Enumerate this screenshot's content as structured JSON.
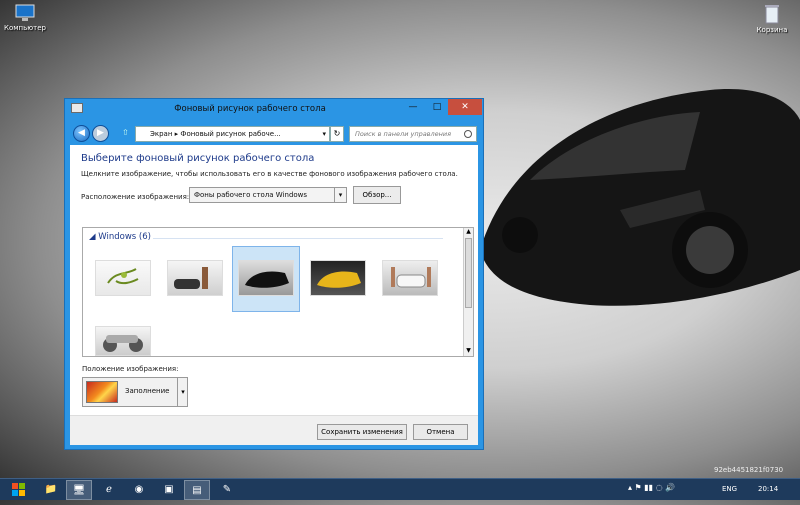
{
  "desktop": {
    "icons": [
      {
        "label": "Компьютер",
        "icon": "computer-icon"
      },
      {
        "label": "Корзина",
        "icon": "recycle-bin-icon"
      }
    ],
    "watermark": "92eb4451821f0730"
  },
  "window": {
    "title": "Фоновый рисунок рабочего стола",
    "buttons": {
      "minimize": "—",
      "maximize": "□",
      "close": "✕"
    },
    "address": {
      "breadcrumb_root": "Экран",
      "breadcrumb_current": "Фоновый рисунок рабоче...",
      "search_placeholder": "Поиск в панели управления"
    },
    "heading": "Выберите фоновый рисунок рабочего стола",
    "description": "Щелкните изображение, чтобы использовать его в качестве фонового изображения рабочего стола.",
    "location": {
      "label": "Расположение изображения:",
      "value": "Фоны рабочего стола Windows",
      "browse_label": "Обзор..."
    },
    "gallery": {
      "group_label": "Windows (6)",
      "items": [
        "plant",
        "woman-car",
        "black-car",
        "yellow-car",
        "white-car",
        "silver-car"
      ],
      "selected_index": 2
    },
    "position": {
      "label": "Положение изображения:",
      "value": "Заполнение"
    },
    "save_label": "Сохранить изменения",
    "cancel_label": "Отмена"
  },
  "taskbar": {
    "lang": "ENG",
    "time": "20:14"
  },
  "colors": {
    "titlebar": "#2b95e4",
    "close": "#c74f3e",
    "heading": "#1d3a8a",
    "selection": "#cce4f7",
    "taskbar": "#1e3a5c"
  }
}
